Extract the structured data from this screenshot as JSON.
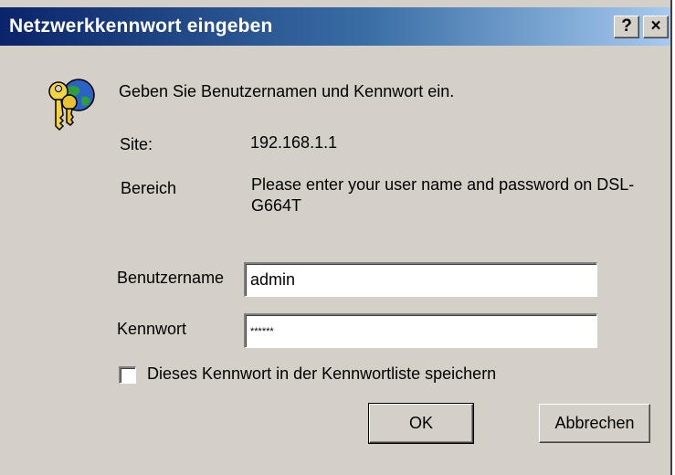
{
  "titlebar": {
    "title": "Netzwerkkennwort eingeben",
    "help_label": "?",
    "close_label": "×"
  },
  "dialog": {
    "prompt": "Geben Sie Benutzernamen und Kennwort ein.",
    "site_label": "Site:",
    "site_value": "192.168.1.1",
    "realm_label": "Bereich",
    "realm_value": "Please enter your user name and password on DSL-G664T",
    "username_label": "Benutzername",
    "username_value": "admin",
    "password_label": "Kennwort",
    "password_value": "******",
    "save_password_label": "Dieses Kennwort in der Kennwortliste speichern",
    "save_password_checked": false,
    "ok_label": "OK",
    "cancel_label": "Abbrechen"
  },
  "icons": {
    "dialog_icon": "keys-globe-icon"
  },
  "colors": {
    "titlebar_start": "#0a246a",
    "titlebar_end": "#a6caf0",
    "dialog_bg": "#d4d0c8"
  }
}
